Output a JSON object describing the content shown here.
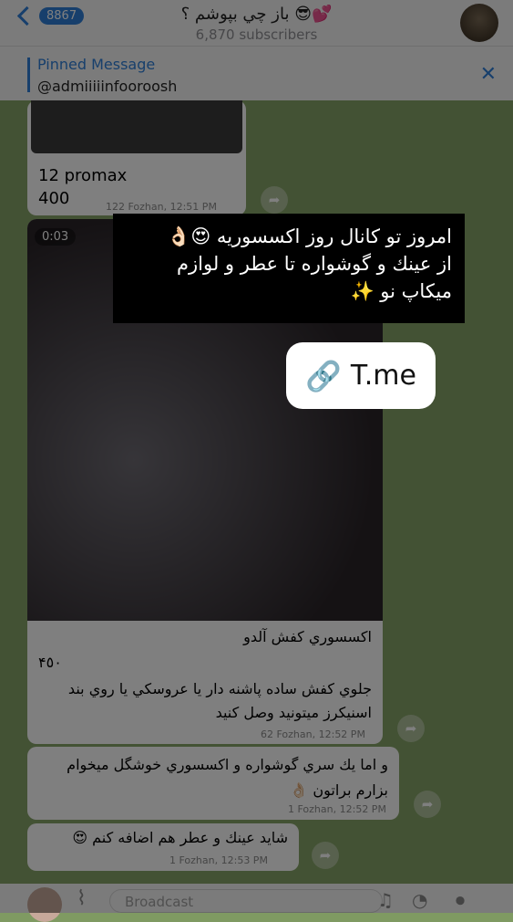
{
  "header": {
    "back_count": "8867",
    "title": "باز چي بپوشم ؟ 😎💕",
    "subscribers": "6,870 subscribers"
  },
  "pinned": {
    "title": "Pinned Message",
    "text": "@admiiiiinfooroosh",
    "close": "✕"
  },
  "messages": [
    {
      "line1": "12 promax",
      "line2": "400",
      "meta": "122 Fozhan, 12:51 PM"
    },
    {
      "video_time": "0:03",
      "caption_title": "اکسسوري کفش آلدو",
      "price": "۴٥۰",
      "body": "جلوي كفش ساده پاشنه دار يا عروسكي يا روي بند اسنيكرز ميتونيد وصل كنيد",
      "meta": "62 Fozhan, 12:52 PM"
    },
    {
      "body": "و اما يك سري گوشواره و اكسسوري خوشگل ميخوام بزارم براتون 👌🏻",
      "meta": "1 Fozhan, 12:52 PM"
    },
    {
      "body": "شايد عينك و عطر هم اضافه كنم 😍",
      "meta": "1 Fozhan, 12:53 PM"
    }
  ],
  "story_overlay": {
    "banner_line1": "امروز تو كانال روز اكسسوريه 😍👌🏻",
    "banner_line2": "از عينك و گوشواره تا عطر و لوازم",
    "banner_line3": "ميكاپ نو ✨",
    "link_label": "T.me"
  },
  "bottom_bar": {
    "placeholder": "Broadcast"
  },
  "colors": {
    "accent": "#2f7fd8",
    "chat_bg": "#86a468"
  }
}
